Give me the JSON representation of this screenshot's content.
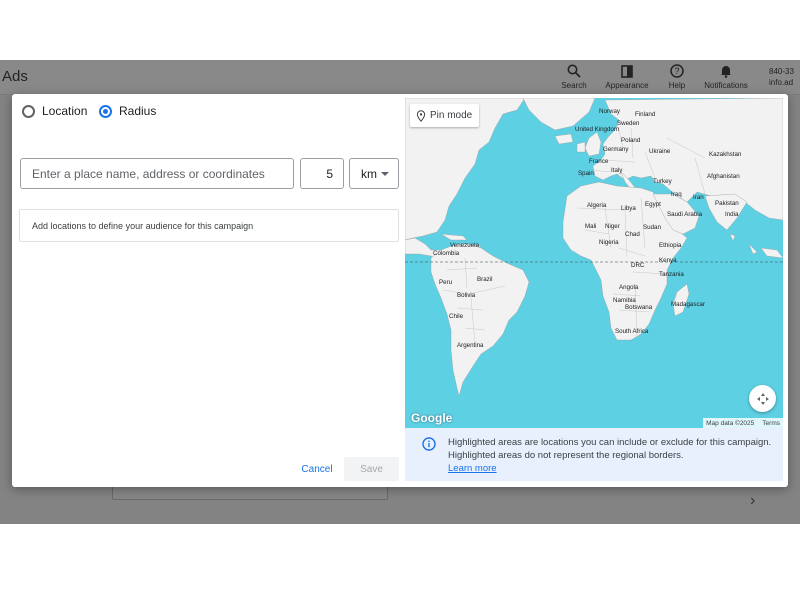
{
  "app": {
    "title": "Ads",
    "toolbar": [
      {
        "label": "Search",
        "icon": "search-icon"
      },
      {
        "label": "Appearance",
        "icon": "appearance-icon"
      },
      {
        "label": "Help",
        "icon": "help-icon"
      },
      {
        "label": "Notifications",
        "icon": "bell-icon"
      }
    ],
    "account": {
      "line1": "840-33",
      "line2": "info.ad"
    }
  },
  "dialog": {
    "radio_location": {
      "label": "Location",
      "selected": false
    },
    "radio_radius": {
      "label": "Radius",
      "selected": true
    },
    "place_input_placeholder": "Enter a place name, address or coordinates",
    "radius_value": "5",
    "unit": "km",
    "hint": "Add locations to define your audience for this campaign",
    "cancel_label": "Cancel",
    "save_label": "Save"
  },
  "map": {
    "pin_mode_label": "Pin mode",
    "logo_text": "Google",
    "attribution": "Map data ©2025",
    "terms": "Terms",
    "water_color": "#5ed0e4",
    "land_color": "#f2f2f2",
    "labels": [
      "Norway",
      "Sweden",
      "Finland",
      "United Kingdom",
      "Poland",
      "Germany",
      "Ukraine",
      "France",
      "Kazakhstan",
      "Spain",
      "Italy",
      "Turkey",
      "Afghanistan",
      "Iraq",
      "Iran",
      "Pakistan",
      "Algeria",
      "Libya",
      "Egypt",
      "Saudi Arabia",
      "India",
      "Mali",
      "Niger",
      "Chad",
      "Sudan",
      "Venezuela",
      "Nigeria",
      "Ethiopia",
      "Colombia",
      "DRC",
      "Kenya",
      "Tanzania",
      "Peru",
      "Brazil",
      "Bolivia",
      "Angola",
      "Namibia",
      "Botswana",
      "Madagascar",
      "Chile",
      "South Africa",
      "Argentina"
    ],
    "info": "Highlighted areas are locations you can include or exclude for this campaign. Highlighted areas do not represent the regional borders.",
    "learn_more": "Learn more"
  }
}
